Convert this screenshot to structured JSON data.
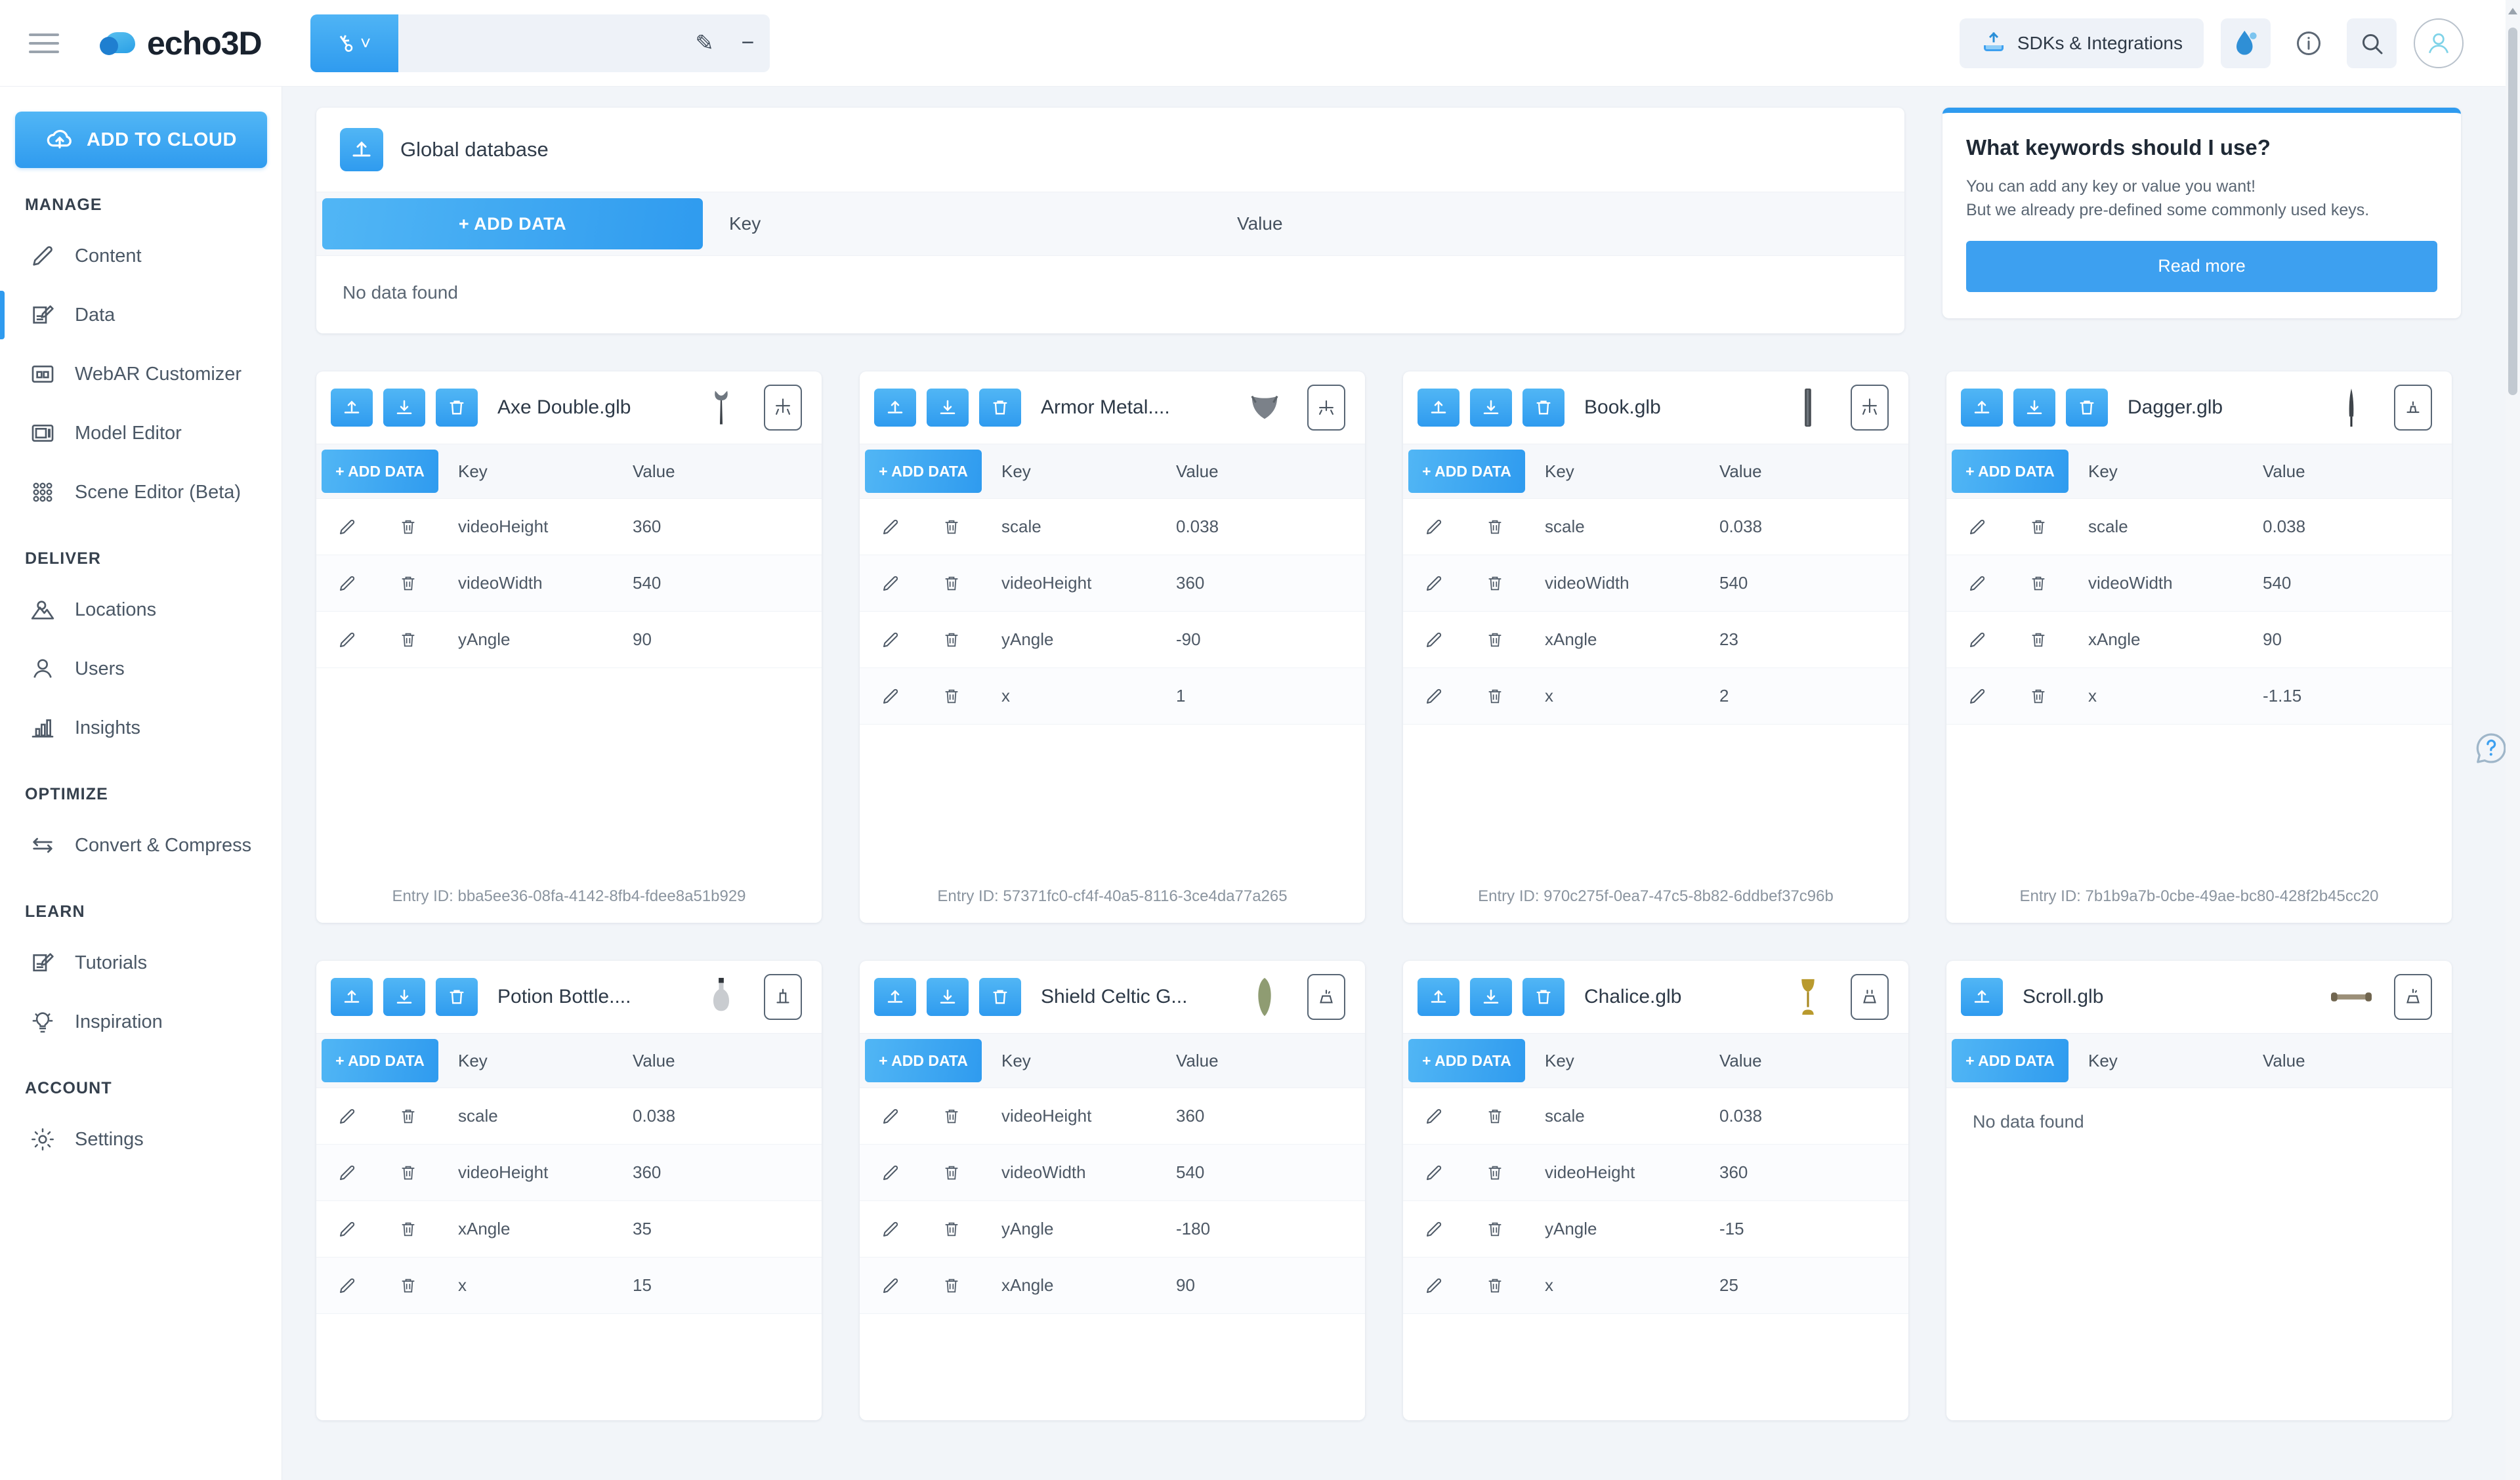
{
  "topbar": {
    "menu_icon": "hamburger-icon",
    "brand": "echo3D",
    "api_key_value": "",
    "api_key_placeholder": "",
    "key_icon": "key-icon",
    "chevron_icon": "chevron-down-icon",
    "edit_icon": "pencil-icon",
    "minus_icon": "minus-icon",
    "sdk_label": "SDKs & Integrations",
    "sdk_icon": "sdk-upload-icon",
    "drop_icon": "water-drop-icon",
    "info_icon": "info-icon",
    "search_icon": "search-icon",
    "avatar_icon": "user-avatar-icon"
  },
  "sidebar": {
    "add_to_cloud": "ADD TO CLOUD",
    "add_to_cloud_icon": "cloud-upload-icon",
    "sections": [
      {
        "title": "MANAGE",
        "items": [
          {
            "label": "Content",
            "icon": "pencil-icon",
            "active": false
          },
          {
            "label": "Data",
            "icon": "note-edit-icon",
            "active": true
          },
          {
            "label": "WebAR Customizer",
            "icon": "layout-columns-icon",
            "active": false
          },
          {
            "label": "Model Editor",
            "icon": "layout-panel-icon",
            "active": false
          },
          {
            "label": "Scene Editor (Beta)",
            "icon": "grid-dots-icon",
            "active": false
          }
        ]
      },
      {
        "title": "DELIVER",
        "items": [
          {
            "label": "Locations",
            "icon": "map-pin-icon",
            "active": false
          },
          {
            "label": "Users",
            "icon": "user-icon",
            "active": false
          },
          {
            "label": "Insights",
            "icon": "bar-chart-icon",
            "active": false
          }
        ]
      },
      {
        "title": "OPTIMIZE",
        "items": [
          {
            "label": "Convert & Compress",
            "icon": "swap-arrows-icon",
            "active": false
          }
        ]
      },
      {
        "title": "LEARN",
        "items": [
          {
            "label": "Tutorials",
            "icon": "note-edit-icon",
            "active": false
          },
          {
            "label": "Inspiration",
            "icon": "lightbulb-icon",
            "active": false
          }
        ]
      },
      {
        "title": "ACCOUNT",
        "items": [
          {
            "label": "Settings",
            "icon": "gear-icon",
            "active": false
          }
        ]
      }
    ]
  },
  "global_database": {
    "title": "Global database",
    "icon": "upload-box-icon",
    "add_data_label": "+ ADD DATA",
    "col_key": "Key",
    "col_value": "Value",
    "empty_text": "No data found"
  },
  "keywords_card": {
    "title": "What keywords should I use?",
    "line1": "You can add any key or value you want!",
    "line2": "But we already pre-defined some commonly used keys.",
    "button": "Read more",
    "accent_color": "#2f9bef"
  },
  "cards_common": {
    "add_data_label": "+ ADD DATA",
    "col_key": "Key",
    "col_value": "Value",
    "empty_text": "No data found",
    "upload_icon": "upload-icon",
    "download_icon": "download-icon",
    "delete_icon": "trash-icon",
    "edit_icon": "pencil-icon",
    "row_delete_icon": "trash-icon",
    "model_badge_icon": "ar-model-icon"
  },
  "entries": [
    {
      "name": "Axe Double.glb",
      "thumb": "axe-thumbnail",
      "has_download": true,
      "has_delete": true,
      "entry_id": "Entry ID: bba5ee36-08fa-4142-8fb4-fdee8a51b929",
      "rows": [
        {
          "key": "videoHeight",
          "value": "360"
        },
        {
          "key": "videoWidth",
          "value": "540"
        },
        {
          "key": "yAngle",
          "value": "90"
        }
      ]
    },
    {
      "name": "Armor Metal....",
      "thumb": "armor-thumbnail",
      "has_download": true,
      "has_delete": true,
      "entry_id": "Entry ID: 57371fc0-cf4f-40a5-8116-3ce4da77a265",
      "rows": [
        {
          "key": "scale",
          "value": "0.038"
        },
        {
          "key": "videoHeight",
          "value": "360"
        },
        {
          "key": "yAngle",
          "value": "-90"
        },
        {
          "key": "x",
          "value": "1"
        }
      ]
    },
    {
      "name": "Book.glb",
      "thumb": "book-thumbnail",
      "has_download": true,
      "has_delete": true,
      "entry_id": "Entry ID: 970c275f-0ea7-47c5-8b82-6ddbef37c96b",
      "rows": [
        {
          "key": "scale",
          "value": "0.038"
        },
        {
          "key": "videoWidth",
          "value": "540"
        },
        {
          "key": "xAngle",
          "value": "23"
        },
        {
          "key": "x",
          "value": "2"
        }
      ]
    },
    {
      "name": "Dagger.glb",
      "thumb": "dagger-thumbnail",
      "has_download": true,
      "has_delete": true,
      "entry_id": "Entry ID: 7b1b9a7b-0cbe-49ae-bc80-428f2b45cc20",
      "rows": [
        {
          "key": "scale",
          "value": "0.038"
        },
        {
          "key": "videoWidth",
          "value": "540"
        },
        {
          "key": "xAngle",
          "value": "90"
        },
        {
          "key": "x",
          "value": "-1.15"
        }
      ]
    },
    {
      "name": "Potion Bottle....",
      "thumb": "potion-bottle-thumbnail",
      "has_download": true,
      "has_delete": true,
      "entry_id": "",
      "rows": [
        {
          "key": "scale",
          "value": "0.038"
        },
        {
          "key": "videoHeight",
          "value": "360"
        },
        {
          "key": "xAngle",
          "value": "35"
        },
        {
          "key": "x",
          "value": "15"
        }
      ]
    },
    {
      "name": "Shield Celtic G...",
      "thumb": "shield-thumbnail",
      "has_download": true,
      "has_delete": true,
      "entry_id": "",
      "rows": [
        {
          "key": "videoHeight",
          "value": "360"
        },
        {
          "key": "videoWidth",
          "value": "540"
        },
        {
          "key": "yAngle",
          "value": "-180"
        },
        {
          "key": "xAngle",
          "value": "90"
        }
      ]
    },
    {
      "name": "Chalice.glb",
      "thumb": "chalice-thumbnail",
      "has_download": true,
      "has_delete": true,
      "entry_id": "",
      "rows": [
        {
          "key": "scale",
          "value": "0.038"
        },
        {
          "key": "videoHeight",
          "value": "360"
        },
        {
          "key": "yAngle",
          "value": "-15"
        },
        {
          "key": "x",
          "value": "25"
        }
      ]
    },
    {
      "name": "Scroll.glb",
      "thumb": "scroll-thumbnail",
      "has_download": false,
      "has_delete": false,
      "entry_id": "",
      "rows": []
    }
  ],
  "help_fab_icon": "question-help-icon"
}
